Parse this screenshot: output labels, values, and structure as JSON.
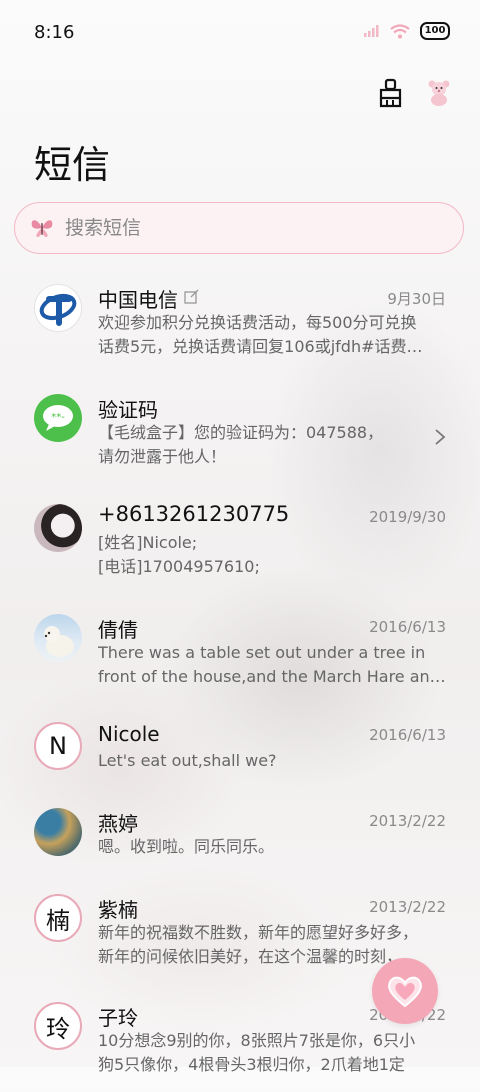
{
  "status": {
    "time": "8:16",
    "battery": "100"
  },
  "header": {
    "title": "短信",
    "clean_icon": "broom-icon",
    "theme_icon": "teddy-bear-icon"
  },
  "search": {
    "placeholder": "搜索短信",
    "icon": "butterfly-icon"
  },
  "conversations": [
    {
      "name": "中国电信",
      "date": "9月30日",
      "line1": "欢迎参加积分兑换话费活动，每500分可兑换",
      "line2": "话费5元，兑换话费请回复106或jfdh#话费…",
      "avatar": "china-telecom-logo"
    },
    {
      "name": "验证码",
      "date": "",
      "line1": "【毛绒盒子】您的验证码为：047588，",
      "line2": "请勿泄露于他人！",
      "avatar": "message-bubble-icon"
    },
    {
      "name": "+8613261230775",
      "date": "2019/9/30",
      "line1": "[姓名]Nicole;",
      "line2": "[电话]17004957610;",
      "avatar": "photo"
    },
    {
      "name": "倩倩",
      "date": "2016/6/13",
      "line1": "There was a table set out under a tree in",
      "line2": "front of the house,and the March Hare an…",
      "avatar": "polar-bear-photo"
    },
    {
      "name": "Nicole",
      "date": "2016/6/13",
      "line1": "Let's eat out,shall we?",
      "line2": "",
      "avatar_letter": "N"
    },
    {
      "name": "燕婷",
      "date": "2013/2/22",
      "line1": "嗯。收到啦。同乐同乐。",
      "line2": "",
      "avatar": "landscape-photo"
    },
    {
      "name": "紫楠",
      "date": "2013/2/22",
      "line1": "新年的祝福数不胜数，新年的愿望好多好多，",
      "line2": "新年的问候依旧美好，在这个温馨的时刻，…",
      "avatar_letter": "楠"
    },
    {
      "name": "子玲",
      "date": "2013/2/22",
      "line1": "10分想念9别的你，8张照片7张是你，6只小",
      "line2": "狗5只像你，4根骨头3根归你，2爪着地1定",
      "avatar_letter": "玲"
    }
  ],
  "fab": {
    "icon": "heart-icon"
  }
}
